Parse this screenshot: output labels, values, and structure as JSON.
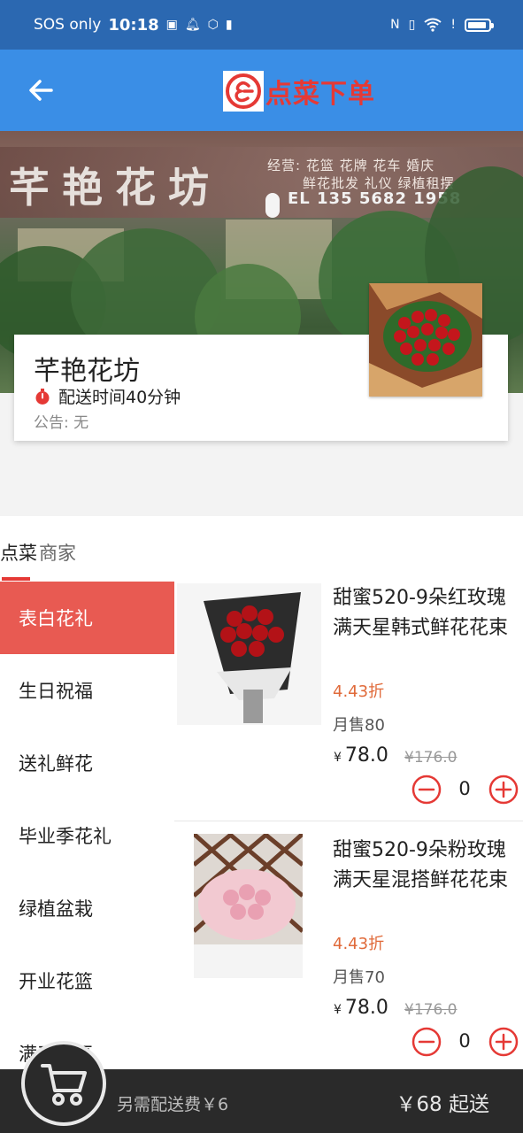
{
  "status_bar": {
    "carrier": "SOS only",
    "time": "10:18"
  },
  "header": {
    "title": "点菜下单"
  },
  "shop": {
    "sign": "芊艳花坊",
    "sign_business": "经营: 花篮 花牌 花车 婚庆",
    "sign_services": "鲜花批发 礼仪 绿植租摆",
    "sign_phone": "EL 135 5682 1958",
    "name": "芊艳花坊",
    "delivery": "配送时间40分钟",
    "notice": "公告: 无"
  },
  "tabs": [
    {
      "label": "点菜",
      "active": true
    },
    {
      "label": "商家",
      "active": false
    }
  ],
  "categories": [
    {
      "label": "表白花礼",
      "active": true
    },
    {
      "label": "生日祝福",
      "active": false
    },
    {
      "label": "送礼鲜花",
      "active": false
    },
    {
      "label": "毕业季花礼",
      "active": false
    },
    {
      "label": "绿植盆栽",
      "active": false
    },
    {
      "label": "开业花篮",
      "active": false
    },
    {
      "label": "满天星区",
      "active": false
    }
  ],
  "products": [
    {
      "name": "甜蜜520-9朵红玫瑰满天星韩式鲜花花束",
      "discount": "4.43折",
      "sold": "月售80",
      "currency": "¥",
      "price": "78.0",
      "original_price": "¥176.0",
      "quantity": "0"
    },
    {
      "name": "甜蜜520-9朵粉玫瑰满天星混搭鲜花花束",
      "discount": "4.43折",
      "sold": "月售70",
      "currency": "¥",
      "price": "78.0",
      "original_price": "¥176.0",
      "quantity": "0"
    }
  ],
  "cart": {
    "delivery_fee": "另需配送费￥6",
    "min_order": "￥68 起送"
  },
  "colors": {
    "status_bar": "#2b68b1",
    "app_bar": "#3a8ee6",
    "accent_red": "#e53935",
    "active_category": "#e85a52",
    "discount": "#e06a3a",
    "cart_bar": "#2a2a2a"
  },
  "icons": {
    "back": "arrow-left-icon",
    "logo": "restaurant-logo-icon",
    "timer": "stopwatch-icon",
    "minus": "minus-circle-icon",
    "plus": "plus-circle-icon",
    "cart": "shopping-cart-icon"
  }
}
